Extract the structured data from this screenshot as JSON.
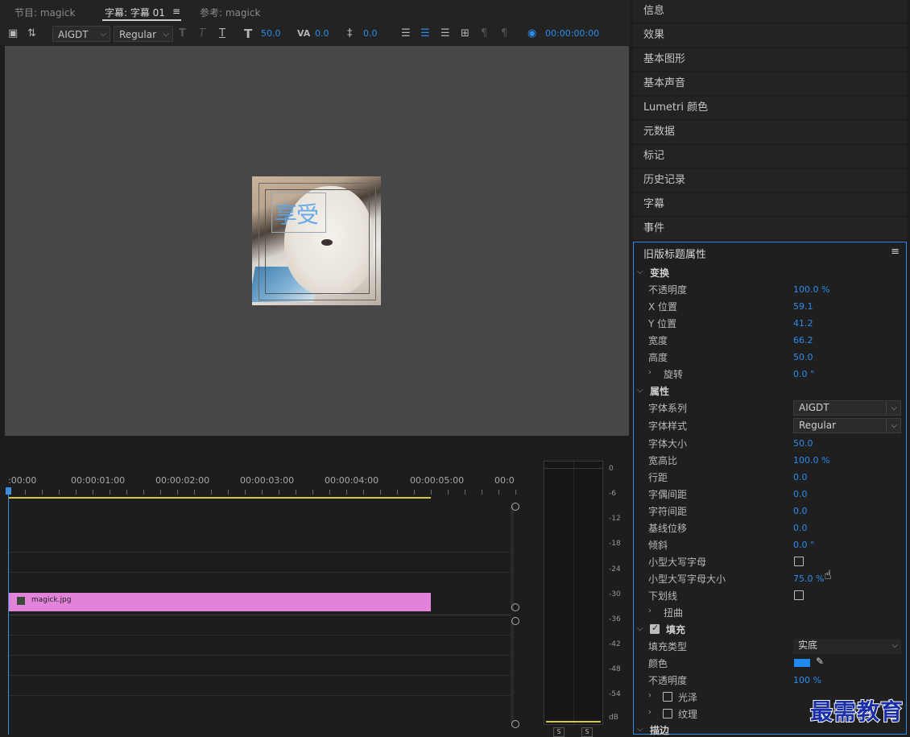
{
  "tabs": [
    {
      "label": "节目: magick"
    },
    {
      "label": "字幕: 字幕 01"
    },
    {
      "label": "参考: magick"
    }
  ],
  "toolbar": {
    "font": "AIGDT",
    "style": "Regular",
    "font_size": "50.0",
    "kerning": "0.0",
    "leading": "0.0",
    "timecode": "00:00:00:00"
  },
  "canvas": {
    "title_text": "享受"
  },
  "timeline": {
    "timecodes": [
      ":00:00",
      "00:00:01:00",
      "00:00:02:00",
      "00:00:03:00",
      "00:00:04:00",
      "00:00:05:00",
      "00:0"
    ],
    "clip_name": "magick.jpg"
  },
  "meter": {
    "db_labels": [
      "0",
      "-6",
      "-12",
      "-18",
      "-24",
      "-30",
      "-36",
      "-42",
      "-48",
      "-54",
      "dB"
    ],
    "solo": [
      "S",
      "S"
    ]
  },
  "panels": [
    "信息",
    "效果",
    "基本图形",
    "基本声音",
    "Lumetri 颜色",
    "元数据",
    "标记",
    "历史记录",
    "字幕",
    "事件"
  ],
  "props": {
    "title": "旧版标题属性",
    "transform": {
      "header": "变换",
      "opacity_label": "不透明度",
      "opacity": "100.0 %",
      "x_label": "X 位置",
      "x": "59.1",
      "y_label": "Y 位置",
      "y": "41.2",
      "width_label": "宽度",
      "width": "66.2",
      "height_label": "高度",
      "height": "50.0",
      "rotation_label": "旋转",
      "rotation": "0.0 °"
    },
    "properties": {
      "header": "属性",
      "font_family_label": "字体系列",
      "font_family": "AIGDT",
      "font_style_label": "字体样式",
      "font_style": "Regular",
      "font_size_label": "字体大小",
      "font_size": "50.0",
      "aspect_label": "宽高比",
      "aspect": "100.0 %",
      "leading_label": "行距",
      "leading": "0.0",
      "kerning_label": "字偶间距",
      "kerning": "0.0",
      "tracking_label": "字符间距",
      "tracking": "0.0",
      "baseline_label": "基线位移",
      "baseline": "0.0",
      "slant_label": "倾斜",
      "slant": "0.0 °",
      "smallcaps_label": "小型大写字母",
      "smallcaps_size_label": "小型大写字母大小",
      "smallcaps_size": "75.0 %",
      "underline_label": "下划线",
      "distort_label": "扭曲"
    },
    "fill": {
      "header": "填充",
      "type_label": "填充类型",
      "type": "实底",
      "color_label": "颜色",
      "color": "#1f8bf0",
      "opacity_label": "不透明度",
      "opacity": "100 %",
      "sheen_label": "光泽",
      "texture_label": "纹理"
    },
    "stroke_header": "描边"
  },
  "watermark": "最需教育"
}
